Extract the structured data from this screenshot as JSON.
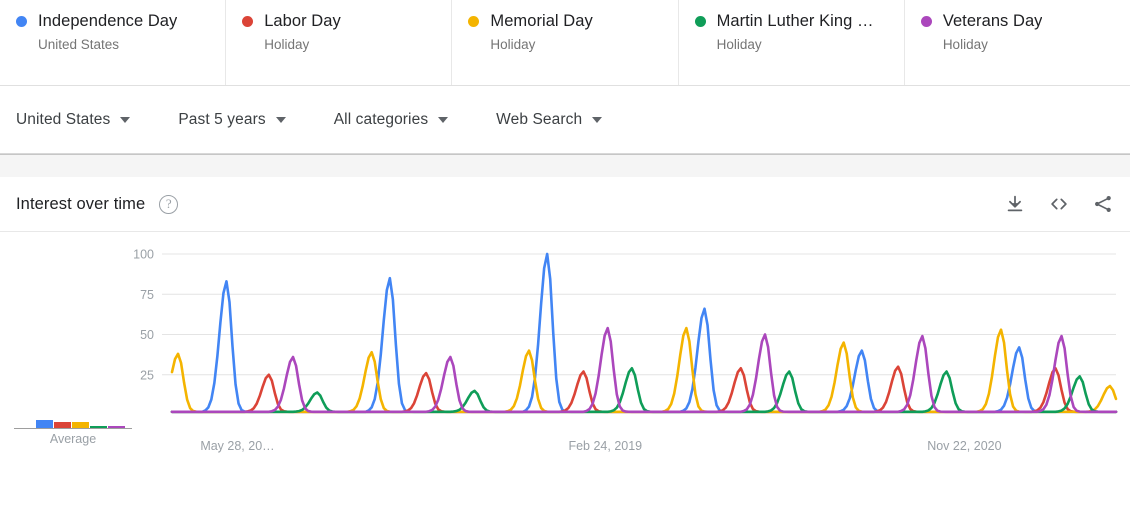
{
  "terms": [
    {
      "name": "Independence Day",
      "sub": "United States",
      "color": "#4285F4",
      "dot": "series-dot"
    },
    {
      "name": "Labor Day",
      "sub": "Holiday",
      "color": "#DB4437",
      "dot": "series-dot"
    },
    {
      "name": "Memorial Day",
      "sub": "Holiday",
      "color": "#F4B400",
      "dot": "series-dot"
    },
    {
      "name": "Martin Luther King …",
      "sub": "Holiday",
      "color": "#0F9D58",
      "dot": "series-dot"
    },
    {
      "name": "Veterans Day",
      "sub": "Holiday",
      "color": "#AB47BC",
      "dot": "series-dot"
    }
  ],
  "filters": [
    {
      "label": "United States"
    },
    {
      "label": "Past 5 years"
    },
    {
      "label": "All categories"
    },
    {
      "label": "Web Search"
    }
  ],
  "card": {
    "title": "Interest over time",
    "help_icon": "help-circle-icon",
    "actions": [
      {
        "icon": "download-icon"
      },
      {
        "icon": "embed-code-icon"
      },
      {
        "icon": "share-icon"
      }
    ]
  },
  "legend": {
    "average_label": "Average",
    "average_values": [
      18,
      15,
      14,
      4,
      4
    ]
  },
  "chart_data": {
    "type": "line",
    "title": "Interest over time",
    "xlabel": "",
    "ylabel": "",
    "ylim": [
      0,
      100
    ],
    "yticks": [
      25,
      50,
      75,
      100
    ],
    "ytick_labels": [
      "25",
      "50",
      "75",
      "100"
    ],
    "grid": true,
    "legend_position": "top",
    "x_tick_labels": [
      "May 28, 20…",
      "Feb 24, 2019",
      "Nov 22, 2020"
    ],
    "x_tick_positions": [
      0.03,
      0.42,
      0.8
    ],
    "x_range_weeks": 156,
    "series": [
      {
        "name": "Independence Day",
        "color": "#4285F4",
        "peaks": [
          {
            "week": 9,
            "value": 83
          },
          {
            "week": 36,
            "value": 85
          },
          {
            "week": 62,
            "value": 100
          },
          {
            "week": 88,
            "value": 66
          },
          {
            "week": 114,
            "value": 40
          },
          {
            "week": 140,
            "value": 42
          }
        ],
        "baseline": 2
      },
      {
        "name": "Labor Day",
        "color": "#DB4437",
        "peaks": [
          {
            "week": 16,
            "value": 25
          },
          {
            "week": 42,
            "value": 26
          },
          {
            "week": 68,
            "value": 27
          },
          {
            "week": 94,
            "value": 29
          },
          {
            "week": 120,
            "value": 30
          },
          {
            "week": 146,
            "value": 29
          }
        ],
        "baseline": 2
      },
      {
        "name": "Memorial Day",
        "color": "#F4B400",
        "peaks": [
          {
            "week": 1,
            "value": 38
          },
          {
            "week": 33,
            "value": 39
          },
          {
            "week": 59,
            "value": 40
          },
          {
            "week": 85,
            "value": 54
          },
          {
            "week": 111,
            "value": 45
          },
          {
            "week": 137,
            "value": 53
          },
          {
            "week": 155,
            "value": 18
          }
        ],
        "baseline": 2
      },
      {
        "name": "Martin Luther King …",
        "color": "#0F9D58",
        "peaks": [
          {
            "week": 24,
            "value": 14
          },
          {
            "week": 50,
            "value": 15
          },
          {
            "week": 76,
            "value": 29
          },
          {
            "week": 102,
            "value": 27
          },
          {
            "week": 128,
            "value": 27
          },
          {
            "week": 150,
            "value": 24
          }
        ],
        "baseline": 2
      },
      {
        "name": "Veterans Day",
        "color": "#AB47BC",
        "peaks": [
          {
            "week": 20,
            "value": 36
          },
          {
            "week": 46,
            "value": 36
          },
          {
            "week": 72,
            "value": 54
          },
          {
            "week": 98,
            "value": 50
          },
          {
            "week": 124,
            "value": 49
          },
          {
            "week": 147,
            "value": 49
          }
        ],
        "baseline": 2
      }
    ]
  }
}
